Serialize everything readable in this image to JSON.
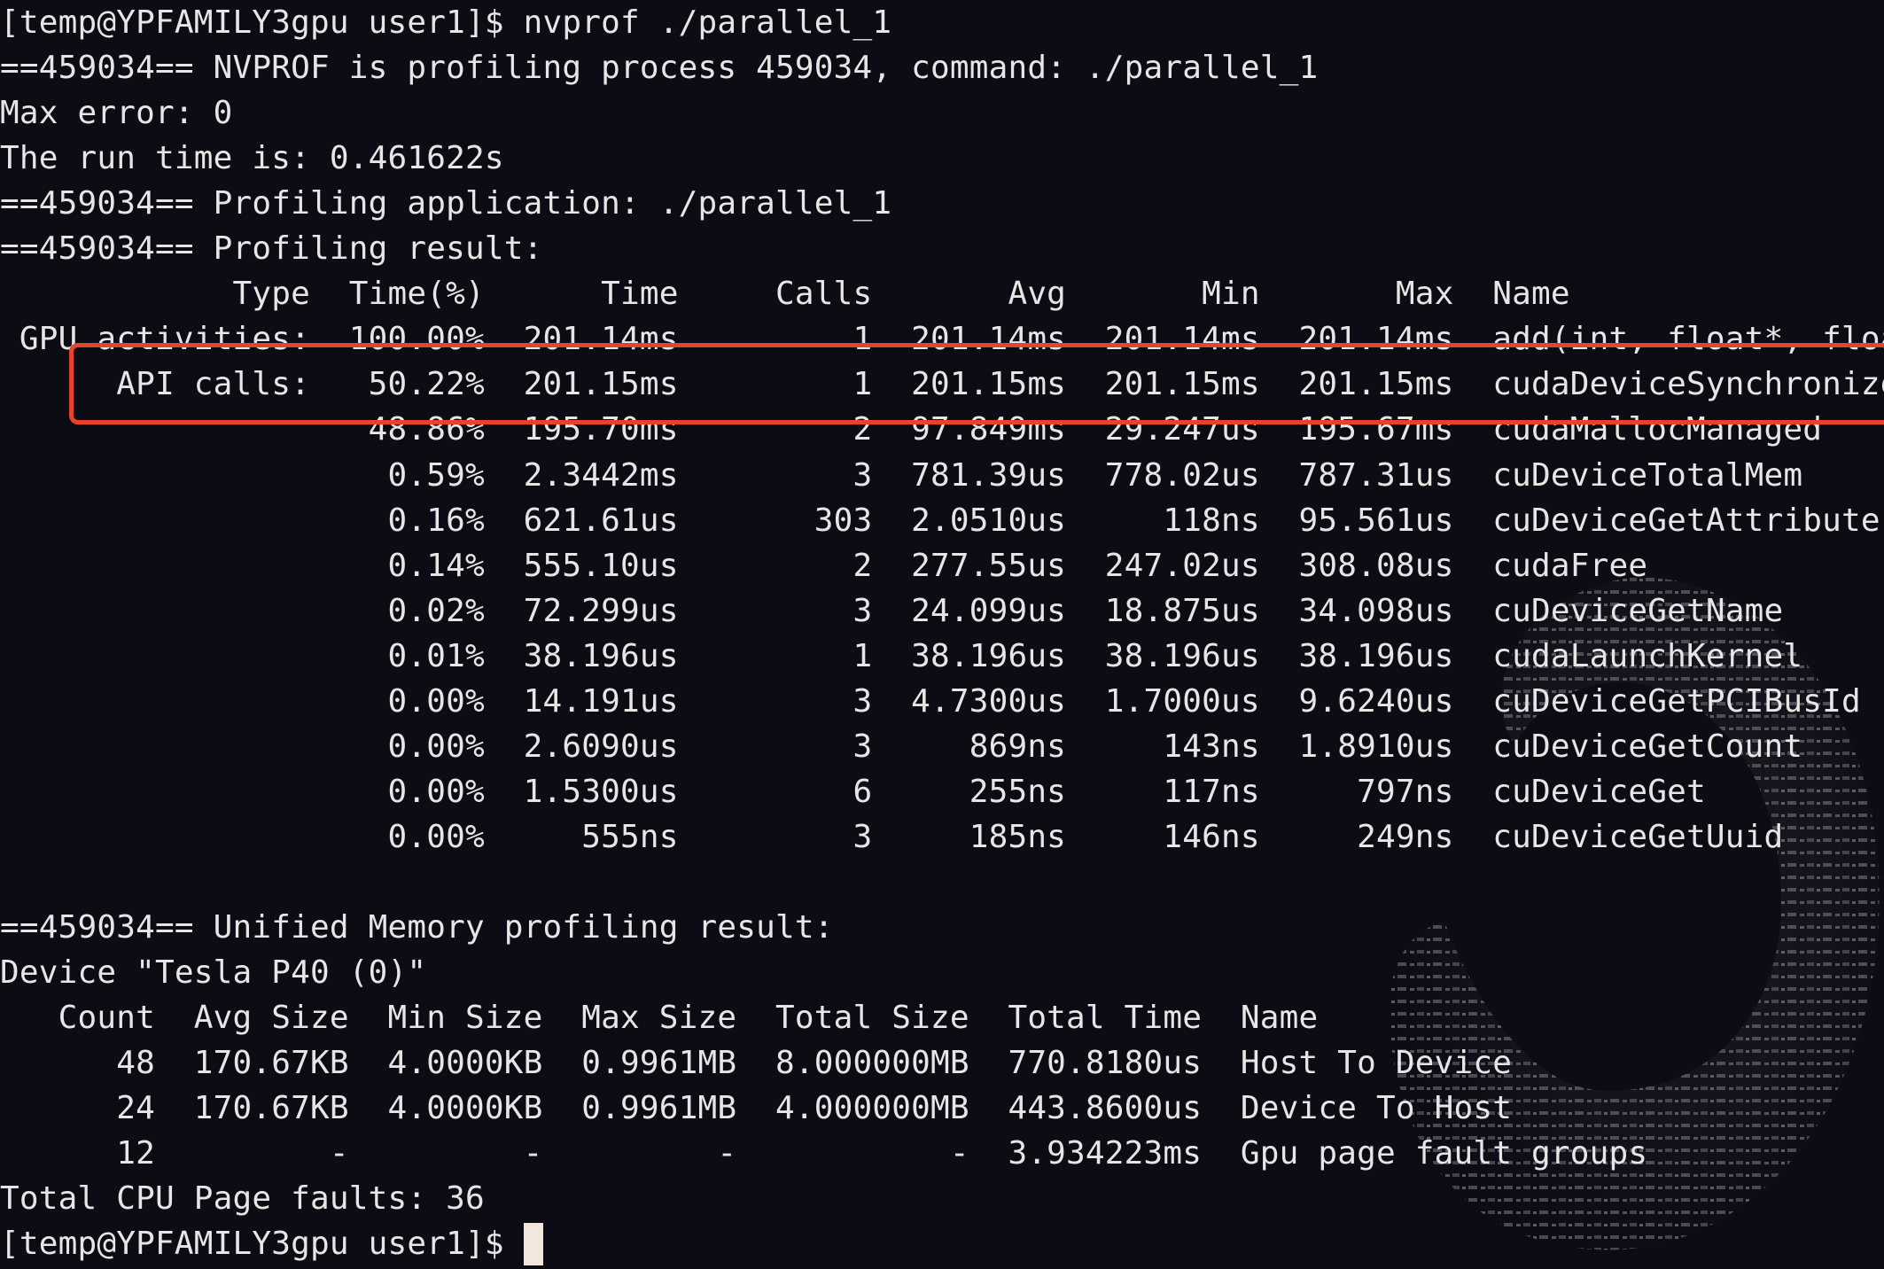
{
  "colors": {
    "background": "#0c0c14",
    "text": "#e6e6e6",
    "highlight": "#e8412c",
    "cursor": "#f2e6df"
  },
  "terminal": {
    "lines": [
      "[temp@YPFAMILY3gpu user1]$ nvprof ./parallel_1",
      "==459034== NVPROF is profiling process 459034, command: ./parallel_1",
      "Max error: 0",
      "The run time is: 0.461622s",
      "==459034== Profiling application: ./parallel_1",
      "==459034== Profiling result:",
      "            Type  Time(%)      Time     Calls       Avg       Min       Max  Name",
      " GPU activities:  100.00%  201.14ms         1  201.14ms  201.14ms  201.14ms  add(int, float*, float*)",
      "      API calls:   50.22%  201.15ms         1  201.15ms  201.15ms  201.15ms  cudaDeviceSynchronize",
      "                   48.86%  195.70ms         2  97.849ms  29.247us  195.67ms  cudaMallocManaged",
      "                    0.59%  2.3442ms         3  781.39us  778.02us  787.31us  cuDeviceTotalMem",
      "                    0.16%  621.61us       303  2.0510us     118ns  95.561us  cuDeviceGetAttribute",
      "                    0.14%  555.10us         2  277.55us  247.02us  308.08us  cudaFree",
      "                    0.02%  72.299us         3  24.099us  18.875us  34.098us  cuDeviceGetName",
      "                    0.01%  38.196us         1  38.196us  38.196us  38.196us  cudaLaunchKernel",
      "                    0.00%  14.191us         3  4.7300us  1.7000us  9.6240us  cuDeviceGetPCIBusId",
      "                    0.00%  2.6090us         3     869ns     143ns  1.8910us  cuDeviceGetCount",
      "                    0.00%  1.5300us         6     255ns     117ns     797ns  cuDeviceGet",
      "                    0.00%     555ns         3     185ns     146ns     249ns  cuDeviceGetUuid",
      "",
      "==459034== Unified Memory profiling result:",
      "Device \"Tesla P40 (0)\"",
      "   Count  Avg Size  Min Size  Max Size  Total Size  Total Time  Name",
      "      48  170.67KB  4.0000KB  0.9961MB  8.000000MB  770.8180us  Host To Device",
      "      24  170.67KB  4.0000KB  0.9961MB  4.000000MB  443.8600us  Device To Host",
      "      12         -         -         -           -  3.934223ms  Gpu page fault groups",
      "Total CPU Page faults: 36",
      "[temp@YPFAMILY3gpu user1]$ "
    ]
  }
}
